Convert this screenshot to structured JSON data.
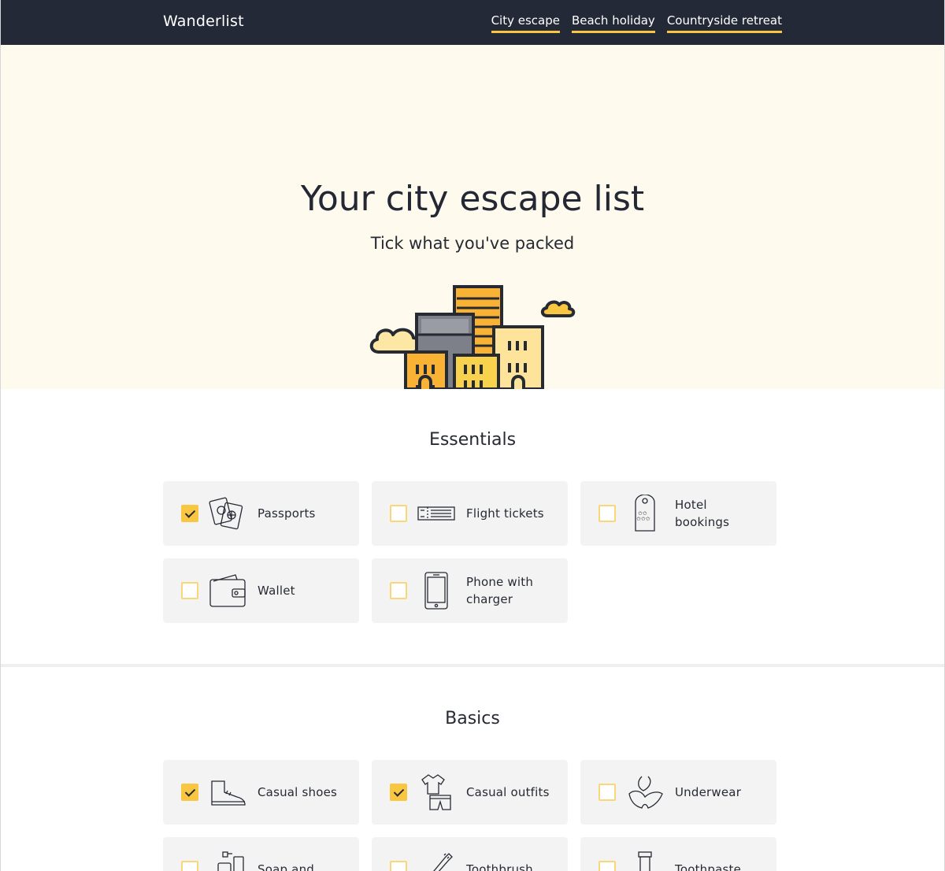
{
  "app": {
    "name": "Wanderlist"
  },
  "nav": [
    {
      "label": "City escape"
    },
    {
      "label": "Beach holiday"
    },
    {
      "label": "Countryside retreat"
    }
  ],
  "hero": {
    "title": "Your city escape list",
    "subtitle": "Tick what you've packed",
    "illustration": "city-buildings-illustration"
  },
  "colors": {
    "accent": "#f9c642",
    "topbar": "#242938",
    "hero_bg": "#fffaee",
    "card_bg": "#f3f3f3"
  },
  "sections": [
    {
      "title": "Essentials",
      "items": [
        {
          "label": "Passports",
          "checked": true,
          "icon": "passports-icon"
        },
        {
          "label": "Flight tickets",
          "checked": false,
          "icon": "flight-ticket-icon"
        },
        {
          "label": "Hotel bookings",
          "checked": false,
          "icon": "hotel-tag-icon"
        },
        {
          "label": "Wallet",
          "checked": false,
          "icon": "wallet-icon"
        },
        {
          "label": "Phone with charger",
          "checked": false,
          "icon": "phone-icon"
        }
      ]
    },
    {
      "title": "Basics",
      "items": [
        {
          "label": "Casual shoes",
          "checked": true,
          "icon": "shoe-icon"
        },
        {
          "label": "Casual outfits",
          "checked": true,
          "icon": "outfit-icon"
        },
        {
          "label": "Underwear",
          "checked": false,
          "icon": "underwear-icon"
        },
        {
          "label": "Soap and",
          "checked": false,
          "icon": "soap-icon"
        },
        {
          "label": "Toothbrush",
          "checked": false,
          "icon": "toothbrush-icon"
        },
        {
          "label": "Toothpaste",
          "checked": false,
          "icon": "toothpaste-icon"
        }
      ]
    }
  ]
}
